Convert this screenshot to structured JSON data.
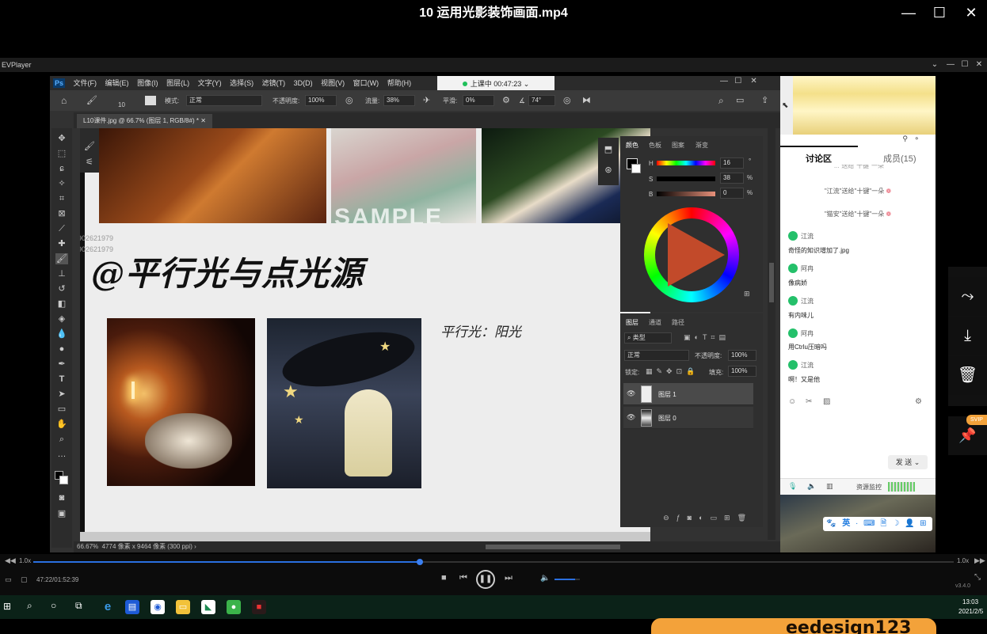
{
  "window": {
    "title": "10 运用光影装饰画面.mp4",
    "minimize": "—",
    "maximize": "☐",
    "close": "✕"
  },
  "evplayer": {
    "title": "EVPlayer",
    "min": "⌄",
    "min2": "—",
    "max": "☐",
    "close": "✕"
  },
  "ps": {
    "logo": "Ps",
    "menu": [
      "文件(F)",
      "编辑(E)",
      "图像(I)",
      "图层(L)",
      "文字(Y)",
      "选择(S)",
      "滤镜(T)",
      "3D(D)",
      "视图(V)",
      "窗口(W)",
      "帮助(H)"
    ],
    "live_badge": "上课中 00:47:23",
    "options": {
      "size": "10",
      "mode_label": "模式:",
      "mode": "正常",
      "opacity_label": "不透明度:",
      "opacity": "100%",
      "flow_label": "流量:",
      "flow": "38%",
      "smooth_label": "平滑:",
      "smooth": "0%",
      "angle": "74°"
    },
    "doc_tab": "L10课件.jpg @ 66.7% (图层 1, RGB/8#) *",
    "canvas": {
      "heading": "@平行光与点光源",
      "note": "平行光：阳光",
      "watermark1": "2902621979",
      "watermark2": "2902621979",
      "sample": "SAMPLE"
    },
    "status": {
      "zoom": "66.67%",
      "size": "4774 像素 x 9464 像素 (300 ppi)"
    },
    "color_panel": {
      "tabs": [
        "颜色",
        "色板",
        "图案",
        "渐变"
      ],
      "h_label": "H",
      "h": "16",
      "s_label": "S",
      "s": "38",
      "b_label": "B",
      "b": "0",
      "unit": "%",
      "deg": "°"
    },
    "layers_panel": {
      "tabs": [
        "图层",
        "通道",
        "路径"
      ],
      "kind": "类型",
      "blend": "正常",
      "opacity_label": "不透明度:",
      "opacity": "100%",
      "lock_label": "锁定:",
      "fill_label": "填充:",
      "fill": "100%",
      "layers": [
        {
          "name": "图层 1"
        },
        {
          "name": "图层 0"
        }
      ]
    }
  },
  "chat": {
    "tab_discuss": "讨论区",
    "tab_members": "成员(15)",
    "partial": "\"...\"送给\"十键\"一朵",
    "system": [
      {
        "text": "\"江流\"送给\"十键\"一朵"
      },
      {
        "text": "\"猫安\"送给\"十键\"一朵"
      }
    ],
    "flower": "❁",
    "messages": [
      {
        "name": "江流",
        "text": "奇怪的知识增加了.jpg"
      },
      {
        "name": "阿冉",
        "text": "像病娇"
      },
      {
        "name": "江流",
        "text": "有内味儿"
      },
      {
        "name": "阿冉",
        "text": "用Ctrlu压暗吗"
      },
      {
        "name": "江流",
        "text": "啊！又是他"
      }
    ],
    "send": "发 送",
    "resource": "资源监控",
    "ime": [
      "🐾",
      "英",
      "·",
      "⌨",
      "🗎",
      "☽",
      "👤",
      "⊞"
    ]
  },
  "side": {
    "share": "⤳",
    "download": "⤓",
    "delete": "🗑",
    "pin": "📌",
    "svip": "SVIP"
  },
  "player": {
    "speed_left": "1.0x",
    "speed_right": "1.0x",
    "time": "47:22/01:52:39",
    "version": "v3.4.0",
    "progress": 0.42,
    "volume": 0.8
  },
  "taskbar": {
    "time": "13:03",
    "date": "2021/2/5",
    "banner": "eedesign123"
  }
}
